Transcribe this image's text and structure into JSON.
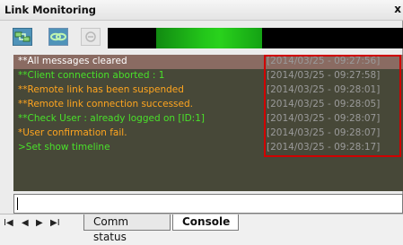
{
  "window": {
    "title": "Link Monitoring",
    "close_glyph": "x"
  },
  "toolbar": {
    "buttons": [
      {
        "icon": "connect-icon",
        "enabled": true
      },
      {
        "icon": "link-icon",
        "enabled": true
      },
      {
        "icon": "disconnect-icon",
        "enabled": false
      }
    ],
    "signal_level": 0.36
  },
  "log": {
    "rows": [
      {
        "message": "**All messages cleared",
        "timestamp": "[2014/03/25 - 09:27:56]",
        "color": "#ffffff",
        "selected": true
      },
      {
        "message": "**Client connection aborted : 1",
        "timestamp": "[2014/03/25 - 09:27:58]",
        "color": "#49e02a",
        "selected": false
      },
      {
        "message": "**Remote link has been suspended",
        "timestamp": "[2014/03/25 - 09:28:01]",
        "color": "#ffa51f",
        "selected": false
      },
      {
        "message": "**Remote link connection successed.",
        "timestamp": "[2014/03/25 - 09:28:05]",
        "color": "#ffa51f",
        "selected": false
      },
      {
        "message": "**Check User : already logged on [ID:1]",
        "timestamp": "[2014/03/25 - 09:28:07]",
        "color": "#49e02a",
        "selected": false
      },
      {
        "message": "*User confirmation fail.",
        "timestamp": "[2014/03/25 - 09:28:07]",
        "color": "#ffa51f",
        "selected": false
      },
      {
        "message": ">Set show timeline",
        "timestamp": "[2014/03/25 - 09:28:17]",
        "color": "#49e02a",
        "selected": false
      }
    ]
  },
  "command": {
    "value": ""
  },
  "bottom": {
    "nav": [
      "I◀",
      "◀",
      "▶",
      "▶I"
    ],
    "tabs": [
      {
        "label": "Comm status",
        "active": false
      },
      {
        "label": "Console",
        "active": true
      }
    ]
  },
  "colors": {
    "highlight": "#d00000",
    "log_bg": "#474838",
    "selected_row": "#8a6b62",
    "timestamp": "#9a9a9a"
  }
}
